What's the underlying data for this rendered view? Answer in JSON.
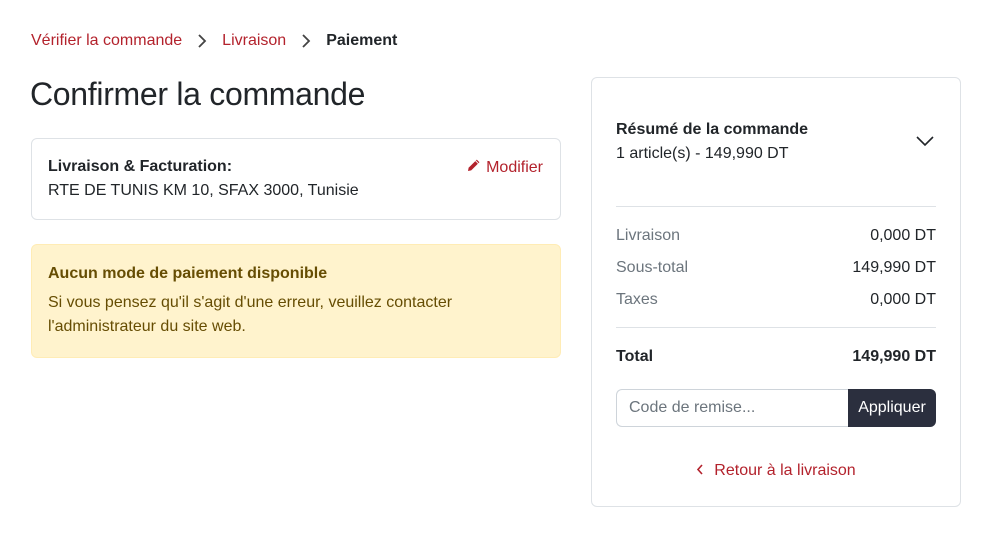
{
  "breadcrumb": {
    "items": [
      "Vérifier la commande",
      "Livraison"
    ],
    "current": "Paiement"
  },
  "page_title": "Confirmer la commande",
  "shipping": {
    "title": "Livraison & Facturation:",
    "address": "RTE DE TUNIS KM 10, SFAX 3000, Tunisie",
    "modify_label": "Modifier",
    "modify_icon": "pencil-icon"
  },
  "alert": {
    "title": "Aucun mode de paiement disponible",
    "line1": "Si vous pensez qu'il s'agit d'une erreur, veuillez contacter",
    "line2": "l'administrateur du site web."
  },
  "summary": {
    "title": "Résumé de la commande",
    "subtitle": "1 article(s) -  149,990 DT",
    "toggle_icon": "chevron-down-icon",
    "rows": [
      {
        "label": "Livraison",
        "value": "0,000 DT"
      },
      {
        "label": "Sous-total",
        "value": "149,990 DT"
      },
      {
        "label": "Taxes",
        "value": "0,000 DT"
      }
    ],
    "total": {
      "label": "Total",
      "value": "149,990 DT"
    },
    "discount": {
      "placeholder": "Code de remise...",
      "value": "",
      "button_label": "Appliquer"
    },
    "back_label": "Retour à la livraison",
    "back_icon": "chevron-left-icon"
  },
  "colors": {
    "accent": "#b3222c",
    "alert_bg": "#fff3cd",
    "alert_text": "#664d03",
    "button_dark": "#2b2f3e"
  }
}
